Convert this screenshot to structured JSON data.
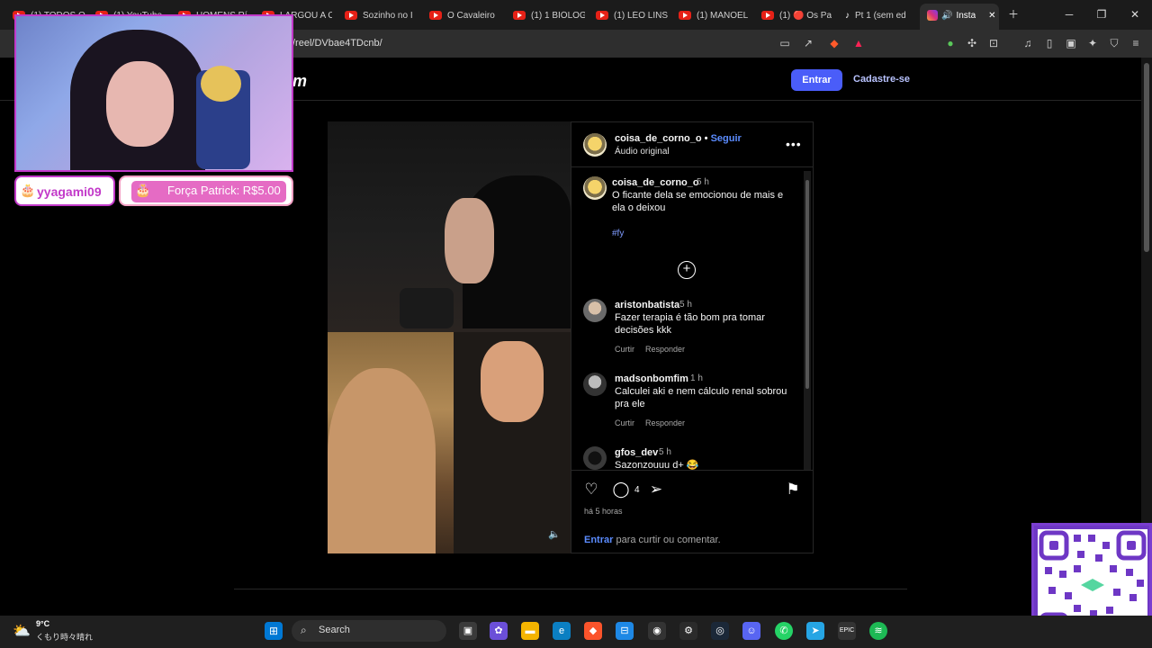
{
  "browser": {
    "tabs": [
      {
        "label": "(1) TODOS O"
      },
      {
        "label": "(1) YouTube"
      },
      {
        "label": "HOMENS Rí"
      },
      {
        "label": "LARGOU A C"
      },
      {
        "label": "Sozinho no I"
      },
      {
        "label": "O Cavaleiro"
      },
      {
        "label": "(1) 1 BIÓLOG"
      },
      {
        "label": "(1) LÉO LINS"
      },
      {
        "label": "(1) MANOEL"
      },
      {
        "label": "(1) 🔴 Os Pa"
      },
      {
        "label": "Pt 1 (sem ed"
      },
      {
        "label": "Insta"
      }
    ],
    "url": "/reel/DVbae4TDcnb/"
  },
  "instagram": {
    "logo": "m",
    "login_button": "Entrar",
    "signup_link": "Cadastre-se",
    "post": {
      "author": "coisa_de_corno_o",
      "follow": "Seguir",
      "audio": "Áudio original",
      "caption_author": "coisa_de_corno_o",
      "caption_time": "5 h",
      "caption": "O ficante dela se emocionou de mais e ela o deixou",
      "hashtag": "#fy",
      "comments": [
        {
          "user": "aristonbatista",
          "time": "5 h",
          "text": "Fazer terapia é tão bom pra tomar decisões kkk",
          "like": "Curtir",
          "reply": "Responder"
        },
        {
          "user": "madsonbomfim",
          "time": "1 h",
          "text": "Calculei aki e nem cálculo renal sobrou pra ele",
          "like": "Curtir",
          "reply": "Responder"
        },
        {
          "user": "gfos_dev",
          "time": "5 h",
          "text": "Sazonzouuu d+ 😂"
        }
      ],
      "comment_count": "4",
      "time_ago": "há 5 horas",
      "login_link": "Entrar",
      "login_prompt": " para curtir ou comentar."
    }
  },
  "overlay": {
    "username_tag": "yyagami09",
    "donation": "Força Patrick: R$5.00"
  },
  "taskbar": {
    "temperature": "9°C",
    "weather_desc": "くもり時々晴れ",
    "search_label": "Search"
  }
}
